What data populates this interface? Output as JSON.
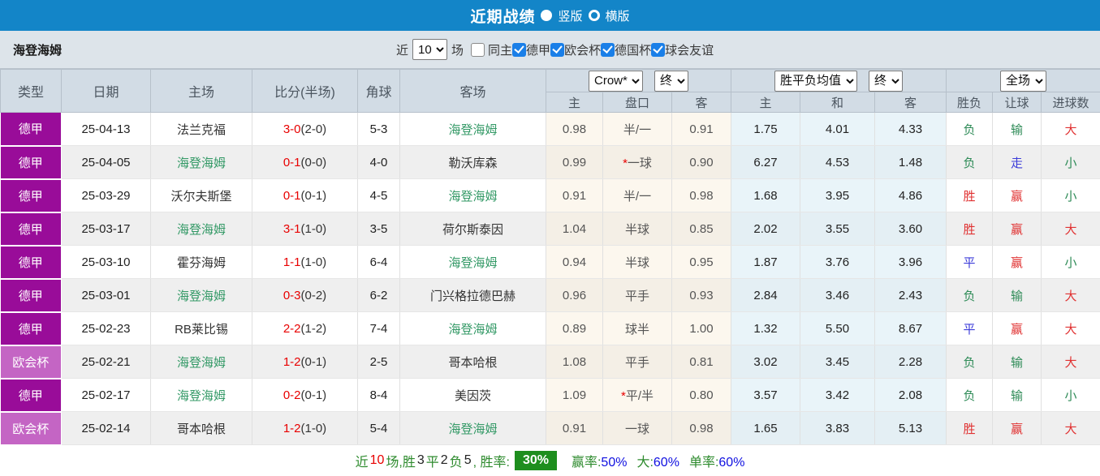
{
  "title_bar": {
    "title": "近期战绩",
    "radio_options": [
      {
        "label": "竖版",
        "selected": true
      },
      {
        "label": "横版",
        "selected": false
      }
    ]
  },
  "filter_bar": {
    "team": "海登海姆",
    "recent_label": "近",
    "recent_value": "10",
    "games_label": "场",
    "checkboxes": [
      {
        "label": "同主",
        "checked": false
      },
      {
        "label": "德甲",
        "checked": true
      },
      {
        "label": "欧会杯",
        "checked": true
      },
      {
        "label": "德国杯",
        "checked": true
      },
      {
        "label": "球会友谊",
        "checked": true
      }
    ]
  },
  "table": {
    "headers": {
      "type": "类型",
      "date": "日期",
      "home": "主场",
      "score": "比分(半场)",
      "corner": "角球",
      "away": "客场",
      "selects": {
        "company": "Crow*",
        "time1": "终",
        "avg": "胜平负均值",
        "time2": "终",
        "scope": "全场"
      },
      "sub": [
        "主",
        "盘口",
        "客",
        "主",
        "和",
        "客",
        "胜负",
        "让球",
        "进球数"
      ]
    },
    "self_team": "海登海姆",
    "league_class": {
      "德甲": "lg-dejia",
      "欧会杯": "lg-ouhui"
    },
    "color_map": {
      "胜": "c-red",
      "平": "c-blue",
      "负": "c-green",
      "赢": "c-red",
      "走": "c-blue",
      "输": "c-green",
      "大": "c-red",
      "小": "c-green"
    },
    "rows": [
      {
        "league": "德甲",
        "date": "25-04-13",
        "home": "法兰克福",
        "score_ft": "3-0",
        "score_ht": "(2-0)",
        "corner": "5-3",
        "away": "海登海姆",
        "o_home": "0.98",
        "o_line": "半/一",
        "o_away": "0.91",
        "a_home": "1.75",
        "a_draw": "4.01",
        "a_away": "4.33",
        "res": "负",
        "let": "输",
        "goal": "大"
      },
      {
        "league": "德甲",
        "date": "25-04-05",
        "home": "海登海姆",
        "score_ft": "0-1",
        "score_ht": "(0-0)",
        "corner": "4-0",
        "away": "勒沃库森",
        "o_home": "0.99",
        "o_line": "*一球",
        "o_away": "0.90",
        "a_home": "6.27",
        "a_draw": "4.53",
        "a_away": "1.48",
        "res": "负",
        "let": "走",
        "goal": "小"
      },
      {
        "league": "德甲",
        "date": "25-03-29",
        "home": "沃尔夫斯堡",
        "score_ft": "0-1",
        "score_ht": "(0-1)",
        "corner": "4-5",
        "away": "海登海姆",
        "o_home": "0.91",
        "o_line": "半/一",
        "o_away": "0.98",
        "a_home": "1.68",
        "a_draw": "3.95",
        "a_away": "4.86",
        "res": "胜",
        "let": "赢",
        "goal": "小"
      },
      {
        "league": "德甲",
        "date": "25-03-17",
        "home": "海登海姆",
        "score_ft": "3-1",
        "score_ht": "(1-0)",
        "corner": "3-5",
        "away": "荷尔斯泰因",
        "o_home": "1.04",
        "o_line": "半球",
        "o_away": "0.85",
        "a_home": "2.02",
        "a_draw": "3.55",
        "a_away": "3.60",
        "res": "胜",
        "let": "赢",
        "goal": "大"
      },
      {
        "league": "德甲",
        "date": "25-03-10",
        "home": "霍芬海姆",
        "score_ft": "1-1",
        "score_ht": "(1-0)",
        "corner": "6-4",
        "away": "海登海姆",
        "o_home": "0.94",
        "o_line": "半球",
        "o_away": "0.95",
        "a_home": "1.87",
        "a_draw": "3.76",
        "a_away": "3.96",
        "res": "平",
        "let": "赢",
        "goal": "小"
      },
      {
        "league": "德甲",
        "date": "25-03-01",
        "home": "海登海姆",
        "score_ft": "0-3",
        "score_ht": "(0-2)",
        "corner": "6-2",
        "away": "门兴格拉德巴赫",
        "o_home": "0.96",
        "o_line": "平手",
        "o_away": "0.93",
        "a_home": "2.84",
        "a_draw": "3.46",
        "a_away": "2.43",
        "res": "负",
        "let": "输",
        "goal": "大"
      },
      {
        "league": "德甲",
        "date": "25-02-23",
        "home": "RB莱比锡",
        "score_ft": "2-2",
        "score_ht": "(1-2)",
        "corner": "7-4",
        "away": "海登海姆",
        "o_home": "0.89",
        "o_line": "球半",
        "o_away": "1.00",
        "a_home": "1.32",
        "a_draw": "5.50",
        "a_away": "8.67",
        "res": "平",
        "let": "赢",
        "goal": "大"
      },
      {
        "league": "欧会杯",
        "date": "25-02-21",
        "home": "海登海姆",
        "score_ft": "1-2",
        "score_ht": "(0-1)",
        "corner": "2-5",
        "away": "哥本哈根",
        "o_home": "1.08",
        "o_line": "平手",
        "o_away": "0.81",
        "a_home": "3.02",
        "a_draw": "3.45",
        "a_away": "2.28",
        "res": "负",
        "let": "输",
        "goal": "大"
      },
      {
        "league": "德甲",
        "date": "25-02-17",
        "home": "海登海姆",
        "score_ft": "0-2",
        "score_ht": "(0-1)",
        "corner": "8-4",
        "away": "美因茨",
        "o_home": "1.09",
        "o_line": "*平/半",
        "o_away": "0.80",
        "a_home": "3.57",
        "a_draw": "3.42",
        "a_away": "2.08",
        "res": "负",
        "let": "输",
        "goal": "小"
      },
      {
        "league": "欧会杯",
        "date": "25-02-14",
        "home": "哥本哈根",
        "score_ft": "1-2",
        "score_ht": "(1-0)",
        "corner": "5-4",
        "away": "海登海姆",
        "o_home": "0.91",
        "o_line": "一球",
        "o_away": "0.98",
        "a_home": "1.65",
        "a_draw": "3.83",
        "a_away": "5.13",
        "res": "胜",
        "let": "赢",
        "goal": "大"
      }
    ]
  },
  "summary": {
    "segments": [
      {
        "t": "近",
        "c": "seg-g"
      },
      {
        "t": "10",
        "c": "seg-r"
      },
      {
        "t": "场,胜",
        "c": "seg-g"
      },
      {
        "t": "3",
        "c": "seg-k"
      },
      {
        "t": "平",
        "c": "seg-g"
      },
      {
        "t": "2",
        "c": "seg-k"
      },
      {
        "t": "负",
        "c": "seg-g"
      },
      {
        "t": "5",
        "c": "seg-k"
      },
      {
        "t": ", 胜率:",
        "c": "seg-g"
      }
    ],
    "win_rate_badge": "30%",
    "stats": [
      {
        "label": "赢率:",
        "value": "50%"
      },
      {
        "label": "大:",
        "value": "60%"
      },
      {
        "label": "单率:",
        "value": "60%"
      }
    ]
  }
}
